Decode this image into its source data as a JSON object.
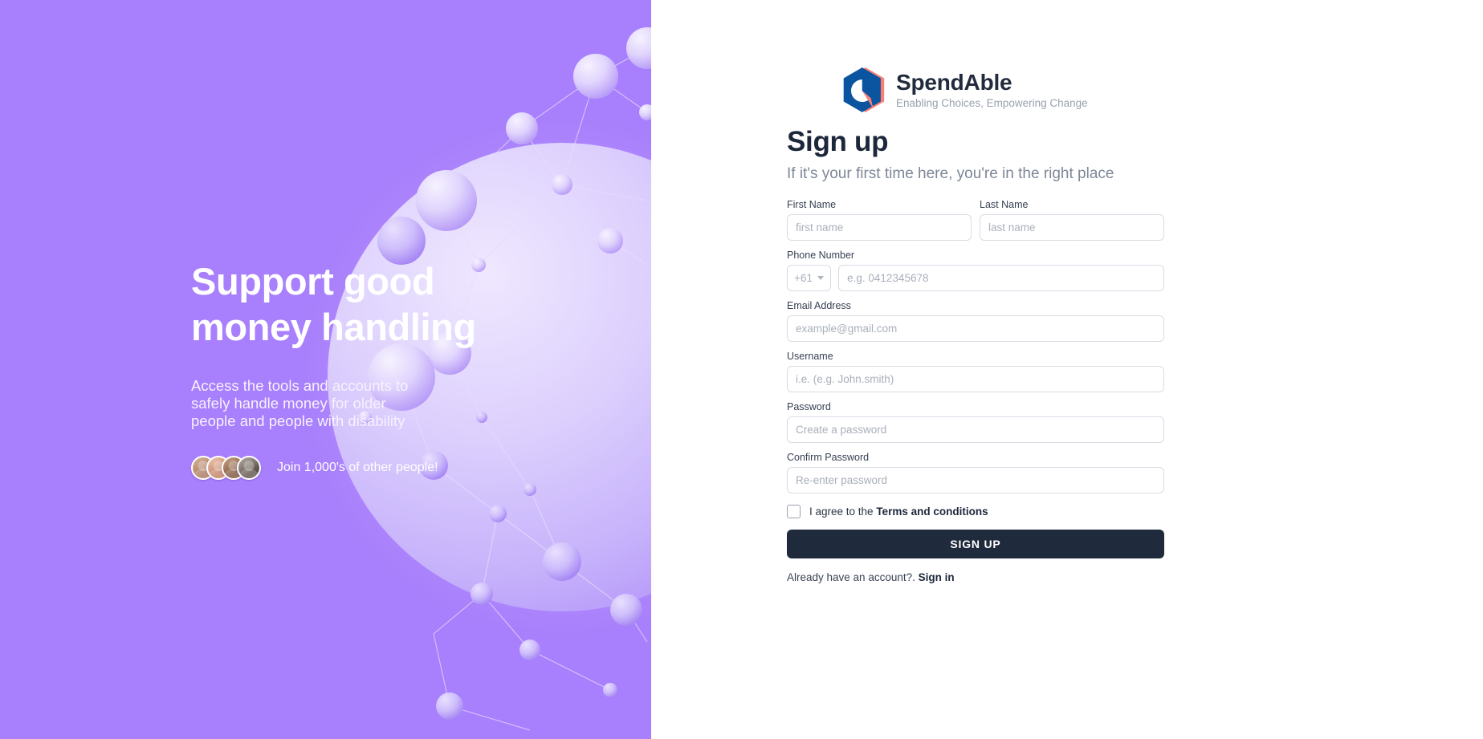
{
  "hero": {
    "title": "Support good\nmoney handling",
    "subtitle": "Access the tools and accounts to safely handle money for older people and people with disability",
    "social_proof": "Join 1,000's of other people!",
    "background_color": "#a87ffc",
    "avatars": [
      {
        "name": "avatar-1"
      },
      {
        "name": "avatar-2"
      },
      {
        "name": "avatar-3"
      },
      {
        "name": "avatar-4"
      }
    ],
    "artwork": "3d-network-spheres-graphic"
  },
  "brand": {
    "name": "SpendAble",
    "tagline": "Enabling Choices, Empowering Change",
    "logo_icon": "spendable-hexagon-logo",
    "logo_colors": {
      "blue": "#0b55a0",
      "coral": "#f98076"
    }
  },
  "form": {
    "title": "Sign up",
    "subtitle": "If it's your first time here, you're in the right place",
    "fields": [
      {
        "id": "first_name",
        "label": "First Name",
        "placeholder": "first name",
        "value": ""
      },
      {
        "id": "last_name",
        "label": "Last Name",
        "placeholder": "last name",
        "value": ""
      },
      {
        "id": "phone",
        "label": "Phone Number",
        "placeholder": "e.g. 0412345678",
        "value": ""
      },
      {
        "id": "email",
        "label": "Email Address",
        "placeholder": "example@gmail.com",
        "value": ""
      },
      {
        "id": "username",
        "label": "Username",
        "placeholder": "i.e. (e.g. John.smith)",
        "value": ""
      },
      {
        "id": "password",
        "label": "Password",
        "placeholder": "Create a password",
        "value": ""
      },
      {
        "id": "confirm_password",
        "label": "Confirm Password",
        "placeholder": "Re-enter password",
        "value": ""
      }
    ],
    "country_code": {
      "selected": "+61"
    },
    "terms": {
      "prefix": "I agree to the ",
      "link_label": "Terms and conditions",
      "checked": false
    },
    "submit_label": "SIGN UP",
    "footer": {
      "prompt": "Already have an account?.",
      "link_label": "Sign in"
    },
    "accent_color": "#1f2a3d"
  }
}
